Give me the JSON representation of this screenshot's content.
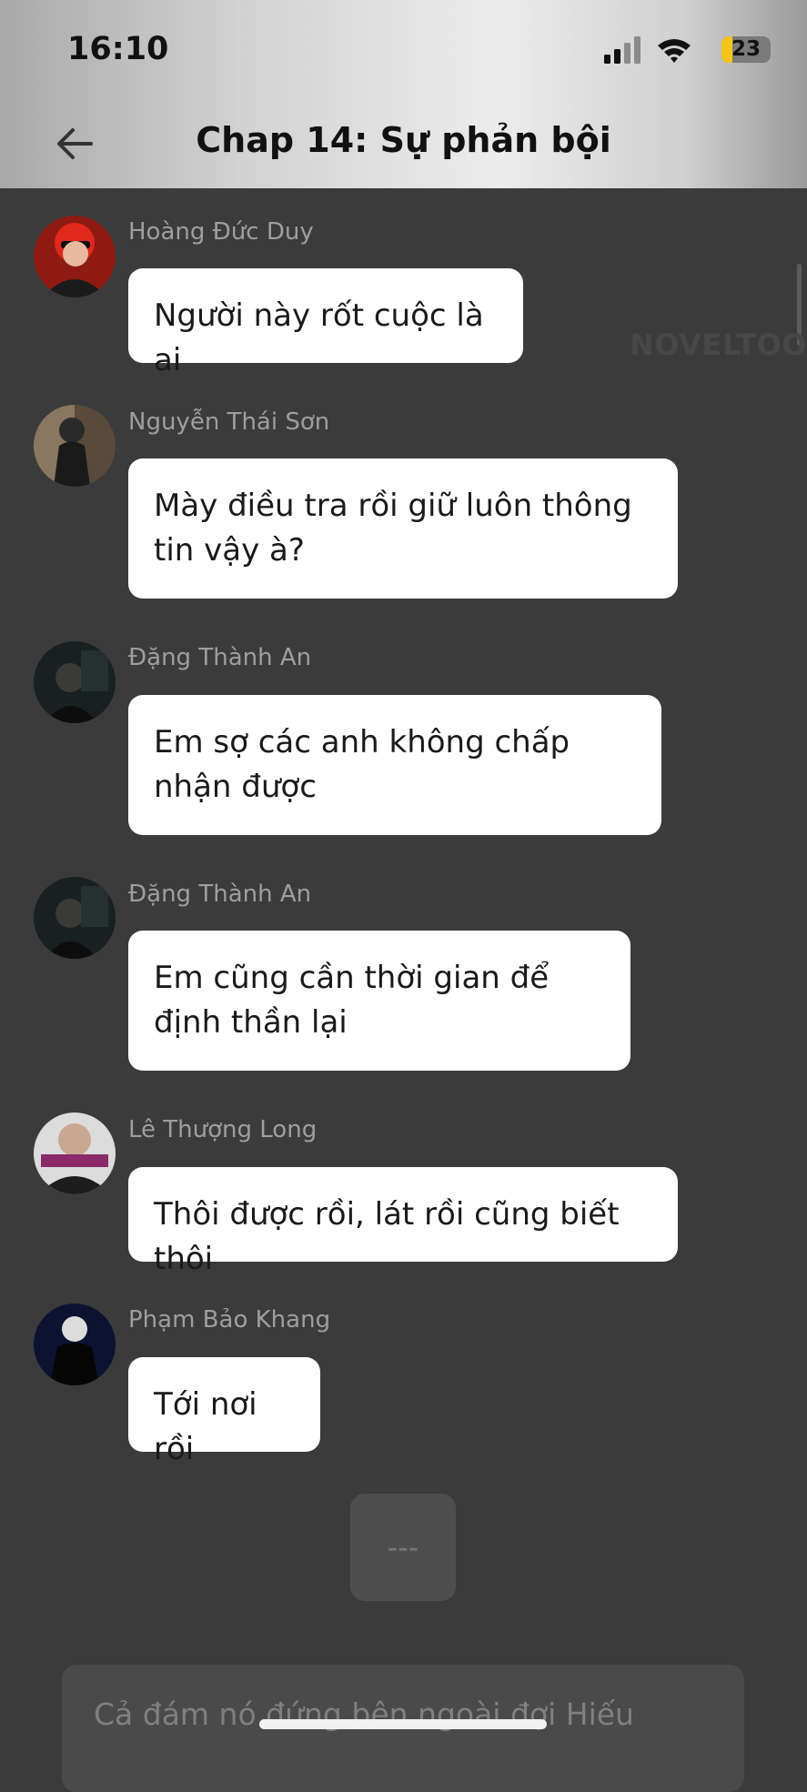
{
  "status_bar": {
    "time": "16:10",
    "battery": "23"
  },
  "header": {
    "title": "Chap 14: Sự phản bội",
    "back_icon": "arrow-left-icon"
  },
  "watermark": "NOVELTOON",
  "messages": [
    {
      "sender": "Hoàng Đức Duy",
      "text": "Người này rốt cuộc là ai"
    },
    {
      "sender": "Nguyễn Thái Sơn",
      "text": "Mày điều tra rồi giữ luôn thông tin vậy à?"
    },
    {
      "sender": "Đặng Thành An",
      "text": "Em sợ các anh không chấp nhận được"
    },
    {
      "sender": "Đặng Thành An",
      "text": "Em cũng cần thời gian để định thần lại"
    },
    {
      "sender": "Lê Thượng Long",
      "text": "Thôi được rồi, lát rồi cũng biết thôi"
    },
    {
      "sender": "Phạm Bảo Khang",
      "text": "Tới nơi rồi"
    }
  ],
  "typing_indicator": "---",
  "next_message_preview": "Cả đám nó đứng bên ngoài đợi Hiếu",
  "colors": {
    "background": "#3b3b3b",
    "bubble": "#ffffff",
    "sender_text": "#9e9e9e"
  }
}
